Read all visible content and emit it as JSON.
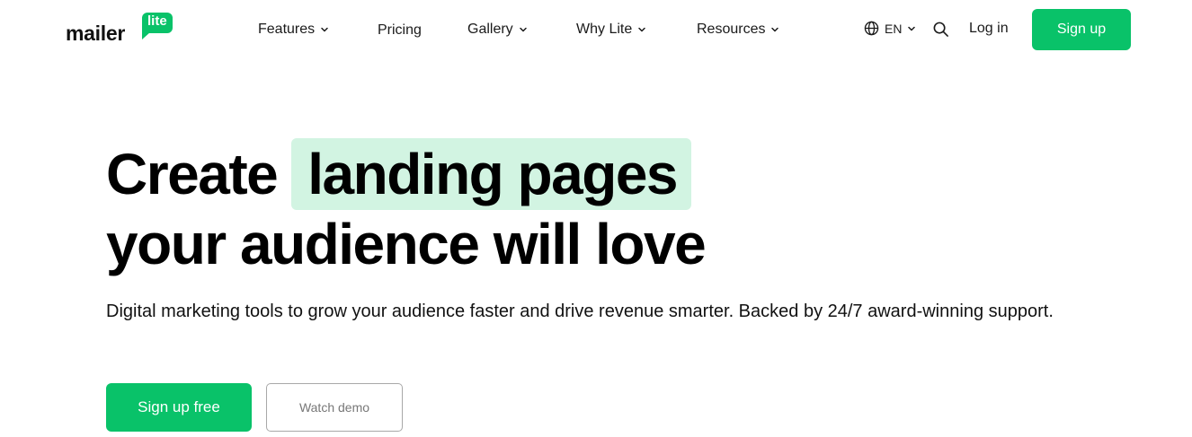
{
  "header": {
    "logo": {
      "word": "mailer",
      "badge": "lite"
    },
    "nav": [
      {
        "label": "Features",
        "has_dropdown": true
      },
      {
        "label": "Pricing",
        "has_dropdown": false
      },
      {
        "label": "Gallery",
        "has_dropdown": true
      },
      {
        "label": "Why Lite",
        "has_dropdown": true
      },
      {
        "label": "Resources",
        "has_dropdown": true
      }
    ],
    "language": "EN",
    "icons": {
      "language": "globe-icon",
      "search": "search-icon",
      "dropdown": "chevron-down-icon"
    },
    "login_label": "Log in",
    "signup_label": "Sign up"
  },
  "hero": {
    "title_plain": "Create",
    "title_highlight": "landing pages",
    "title_line2": "your audience will love",
    "subtitle": "Digital marketing tools to grow your audience faster and drive revenue smarter. Backed by 24/7 award-winning support.",
    "primary_cta": "Sign up free",
    "secondary_cta": "Watch demo"
  },
  "colors": {
    "brand_green": "#09c269",
    "highlight_bg": "#d2f4e2",
    "text": "#111111"
  }
}
